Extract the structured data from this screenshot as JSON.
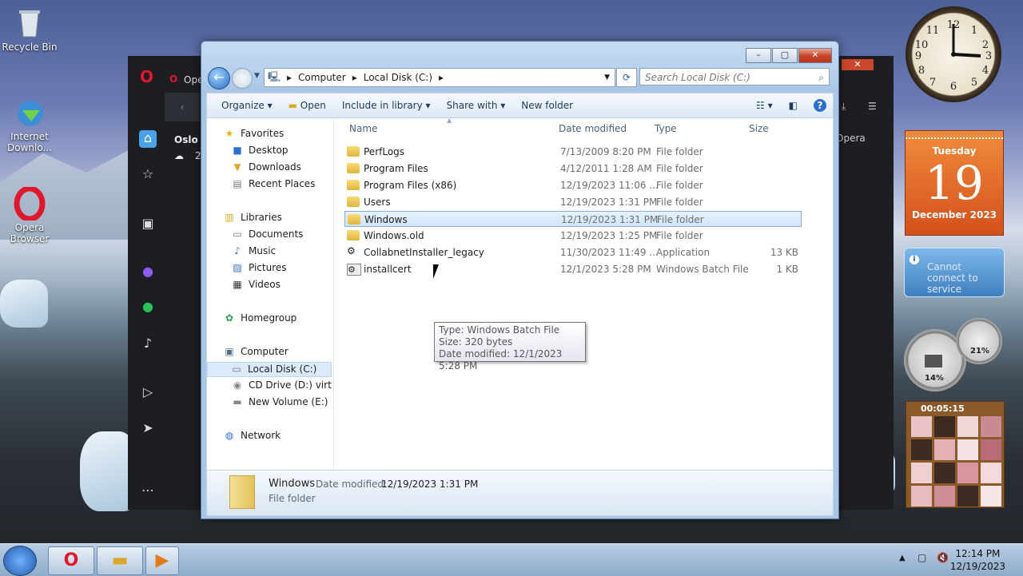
{
  "desktop": {
    "icons": [
      {
        "label": "Recycle Bin",
        "icon": "recycle-bin-icon"
      },
      {
        "label": "Internet Downlo...",
        "icon": "internet-download-manager-icon"
      },
      {
        "label": "Opera Browser",
        "icon": "opera-icon"
      }
    ]
  },
  "opera_window": {
    "tab_partial": "Ope",
    "city": "Oslo",
    "temp_partial": "2",
    "side_label": "Opera"
  },
  "explorer": {
    "breadcrumb": [
      "Computer",
      "Local Disk (C:)"
    ],
    "search_placeholder": "Search Local Disk (C:)",
    "toolbar": {
      "organize": "Organize",
      "open": "Open",
      "include": "Include in library",
      "share": "Share with",
      "new_folder": "New folder"
    },
    "nav": {
      "favorites": "Favorites",
      "desktop": "Desktop",
      "downloads": "Downloads",
      "recent": "Recent Places",
      "libraries": "Libraries",
      "documents": "Documents",
      "music": "Music",
      "pictures": "Pictures",
      "videos": "Videos",
      "homegroup": "Homegroup",
      "computer": "Computer",
      "local_disk": "Local Disk (C:)",
      "cd_drive": "CD Drive (D:) virtio-w",
      "new_volume": "New Volume (E:)",
      "network": "Network"
    },
    "columns": {
      "name": "Name",
      "date": "Date modified",
      "type": "Type",
      "size": "Size"
    },
    "files": [
      {
        "name": "PerfLogs",
        "date": "7/13/2009 8:20 PM",
        "type": "File folder",
        "size": "",
        "kind": "folder"
      },
      {
        "name": "Program Files",
        "date": "4/12/2011 1:28 AM",
        "type": "File folder",
        "size": "",
        "kind": "folder"
      },
      {
        "name": "Program Files (x86)",
        "date": "12/19/2023 11:06 ...",
        "type": "File folder",
        "size": "",
        "kind": "folder"
      },
      {
        "name": "Users",
        "date": "12/19/2023 1:31 PM",
        "type": "File folder",
        "size": "",
        "kind": "folder"
      },
      {
        "name": "Windows",
        "date": "12/19/2023 1:31 PM",
        "type": "File folder",
        "size": "",
        "kind": "folder",
        "selected": true
      },
      {
        "name": "Windows.old",
        "date": "12/19/2023 1:25 PM",
        "type": "File folder",
        "size": "",
        "kind": "folder"
      },
      {
        "name": "CollabnetInstaller_legacy",
        "date": "11/30/2023 11:49 ...",
        "type": "Application",
        "size": "13 KB",
        "kind": "app"
      },
      {
        "name": "installcert",
        "date": "12/1/2023 5:28 PM",
        "type": "Windows Batch File",
        "size": "1 KB",
        "kind": "batch"
      }
    ],
    "tooltip": {
      "type": "Type: Windows Batch File",
      "size": "Size: 320 bytes",
      "date": "Date modified: 12/1/2023 5:28 PM"
    },
    "details": {
      "name": "Windows",
      "date_label": "Date modified:",
      "date": "12/19/2023 1:31 PM",
      "type": "File folder"
    }
  },
  "gadgets": {
    "calendar": {
      "weekday": "Tuesday",
      "day": "19",
      "month": "December 2023"
    },
    "weather": "Cannot connect to service",
    "cpu": "14%",
    "mem": "21%",
    "puzzle_timer": "00:05:15"
  },
  "taskbar": {
    "time": "12:14 PM",
    "date": "12/19/2023"
  }
}
